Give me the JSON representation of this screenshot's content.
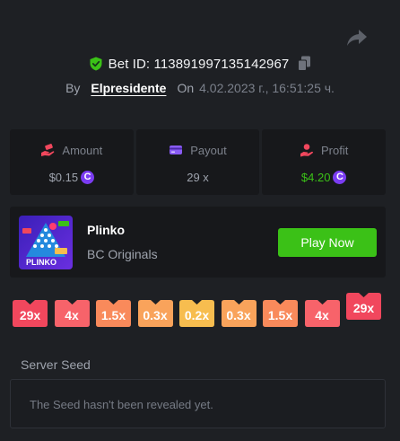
{
  "header": {
    "bet_id_label": "Bet ID:",
    "bet_id": "113891997135142967",
    "by_label": "By",
    "username": "Elpresidente",
    "on_label": "On",
    "date": "4.02.2023 г., 16:51:25 ч."
  },
  "stats": {
    "amount": {
      "label": "Amount",
      "value": "$0.15",
      "coin": "C"
    },
    "payout": {
      "label": "Payout",
      "value": "29 x"
    },
    "profit": {
      "label": "Profit",
      "value": "$4.20",
      "coin": "C"
    }
  },
  "game": {
    "name": "Plinko",
    "provider": "BC Originals",
    "play_label": "Play Now",
    "thumb_text": "PLINKO"
  },
  "multipliers": [
    {
      "label": "29x",
      "color": "#f1475d",
      "active": false
    },
    {
      "label": "4x",
      "color": "#f7636a",
      "active": false
    },
    {
      "label": "1.5x",
      "color": "#f98a5b",
      "active": false
    },
    {
      "label": "0.3x",
      "color": "#f9a35b",
      "active": false
    },
    {
      "label": "0.2x",
      "color": "#f7bd4f",
      "active": false
    },
    {
      "label": "0.3x",
      "color": "#f9a35b",
      "active": false
    },
    {
      "label": "1.5x",
      "color": "#f98a5b",
      "active": false
    },
    {
      "label": "4x",
      "color": "#f7636a",
      "active": false
    },
    {
      "label": "29x",
      "color": "#f1475d",
      "active": true
    }
  ],
  "server_seed": {
    "label": "Server Seed",
    "value": "The Seed hasn't been revealed yet."
  },
  "colors": {
    "accent_green": "#3bc117",
    "coin_purple": "#7b3cf2",
    "panel": "#17181b"
  }
}
